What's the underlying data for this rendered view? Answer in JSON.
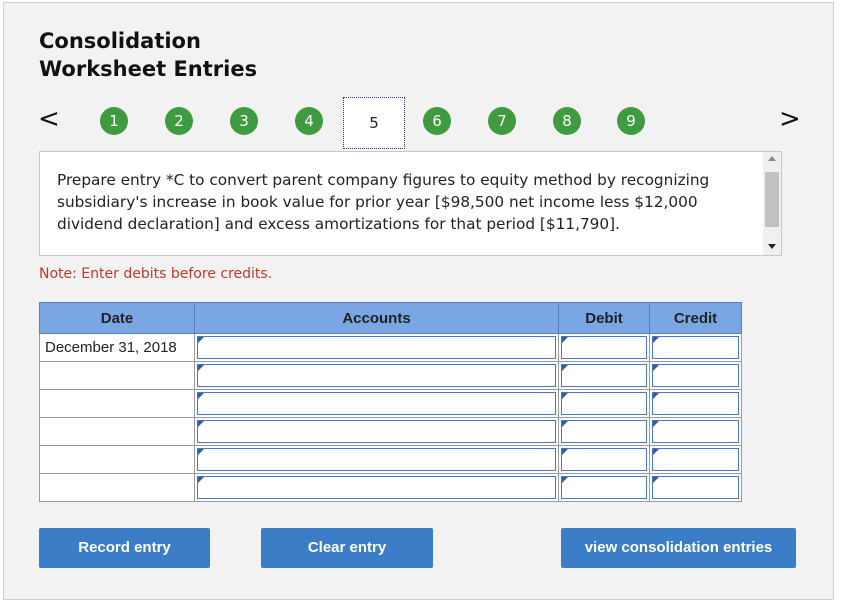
{
  "title_line1": "Consolidation",
  "title_line2": "Worksheet Entries",
  "nav": {
    "prev": "<",
    "next": ">"
  },
  "steps": [
    "1",
    "2",
    "3",
    "4",
    "5",
    "6",
    "7",
    "8",
    "9"
  ],
  "current_step": "5",
  "prompt_text": "Prepare entry *C to convert parent company figures to equity method by recognizing subsidiary's increase in book value for prior year [$98,500 net income less $12,000 dividend declaration] and excess amortizations for that period [$11,790].",
  "note": "Note: Enter debits before credits.",
  "table": {
    "headers": {
      "date": "Date",
      "accounts": "Accounts",
      "debit": "Debit",
      "credit": "Credit"
    },
    "rows": [
      {
        "date": "December 31, 2018"
      },
      {
        "date": ""
      },
      {
        "date": ""
      },
      {
        "date": ""
      },
      {
        "date": ""
      },
      {
        "date": ""
      }
    ]
  },
  "buttons": {
    "record": "Record entry",
    "clear": "Clear entry",
    "view": "view consolidation entries"
  },
  "colors": {
    "step_green": "#3f9b3f",
    "header_blue": "#7aa7e3",
    "button_blue": "#3b7dc6",
    "note_red": "#c0392b"
  }
}
